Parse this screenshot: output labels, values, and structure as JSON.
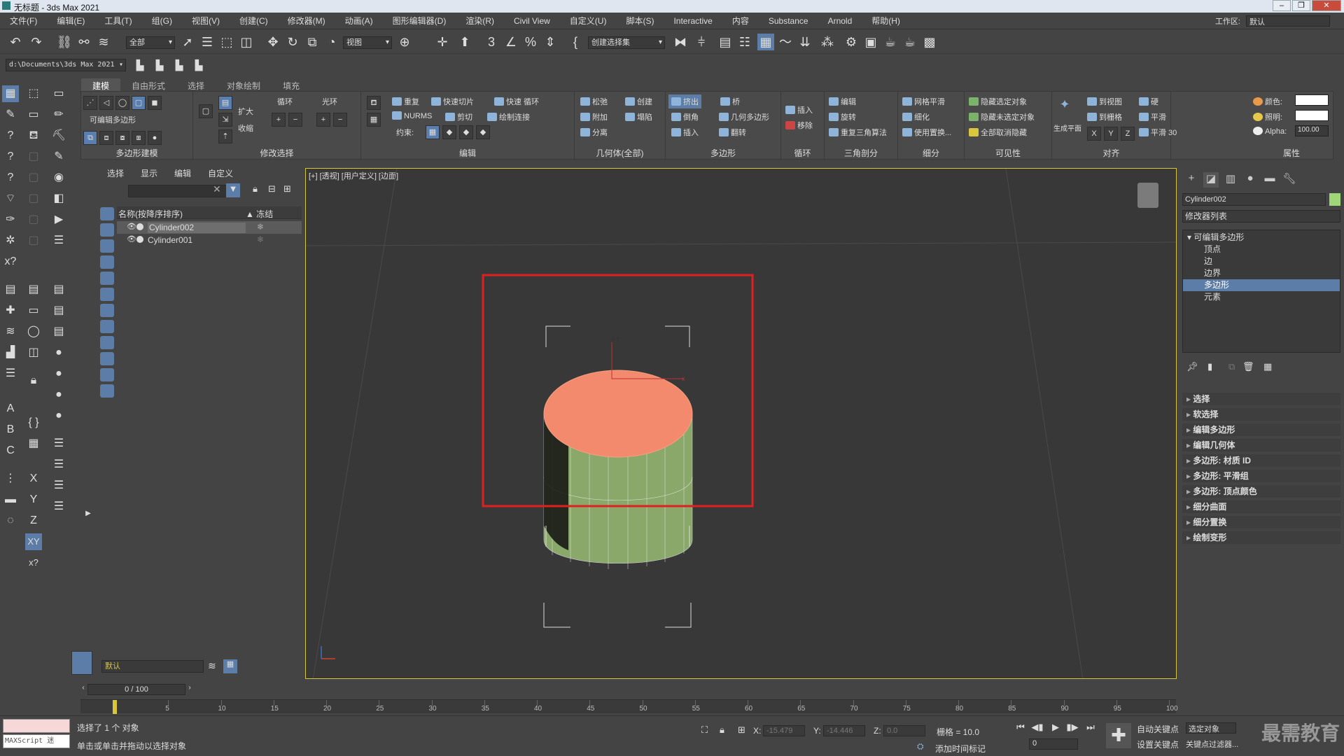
{
  "window": {
    "title": "无标题 - 3ds Max 2021"
  },
  "menu": [
    "文件(F)",
    "编辑(E)",
    "工具(T)",
    "组(G)",
    "视图(V)",
    "创建(C)",
    "修改器(M)",
    "动画(A)",
    "图形编辑器(D)",
    "渲染(R)",
    "Civil View",
    "自定义(U)",
    "脚本(S)",
    "Interactive",
    "内容",
    "Substance",
    "Arnold",
    "帮助(H)"
  ],
  "workspace": {
    "label": "工作区:",
    "value": "默认"
  },
  "toolbar": {
    "selection_filter": "全部",
    "ref_coord": "视图",
    "named_selection": "创建选择集",
    "project_path": "d:\\Documents\\3ds Max 2021"
  },
  "ribbon": {
    "tabs": [
      "建模",
      "自由形式",
      "选择",
      "对象绘制",
      "填充"
    ],
    "sections": {
      "poly_modeling": {
        "label": "多边形建模",
        "sub": "可编辑多边形"
      },
      "modify_selection": {
        "label": "修改选择",
        "grow": "扩大",
        "shrink": "收缩",
        "loop": "循环",
        "ring": "光环"
      },
      "edit": {
        "label": "编辑",
        "repeat": "重复",
        "quickslice": "快速切片",
        "quickloop": "快速 循环",
        "nurms": "NURMS",
        "cut": "剪切",
        "paintconnect": "绘制连接",
        "constraint": "约束:"
      },
      "geometry": {
        "label": "几何体(全部)",
        "relax": "松弛",
        "create": "创建",
        "attach": "附加",
        "collapse": "塌陷",
        "detach": "分离"
      },
      "polygons": {
        "label": "多边形",
        "extrude": "挤出",
        "bridge": "桥",
        "bevel": "倒角",
        "geopoly": "几何多边形",
        "inset": "插入",
        "flip": "翻转"
      },
      "loops": {
        "label": "循环",
        "insert": "插入",
        "remove": "移除"
      },
      "tris": {
        "label": "三角剖分",
        "edit": "编辑",
        "turn": "旋转",
        "retri": "重复三角算法"
      },
      "subdiv": {
        "label": "细分",
        "meshsmooth": "网格平滑",
        "tess": "细化",
        "usedisp": "使用置换..."
      },
      "vis": {
        "label": "可见性",
        "hidesel": "隐藏选定对象",
        "hideunsel": "隐藏未选定对象",
        "unhide": "全部取消隐藏"
      },
      "align": {
        "label": "对齐",
        "makeplanar": "生成平面",
        "toview": "到视图",
        "togrid": "到栅格",
        "x": "X",
        "y": "Y",
        "z": "Z"
      },
      "smooth": {
        "hard": "硬",
        "smooth": "平滑",
        "smooth30": "平滑 30"
      },
      "props": {
        "label": "属性",
        "color": "颜色:",
        "illum": "照明:",
        "alpha": "Alpha:",
        "alpha_val": "100.00"
      }
    }
  },
  "scene_explorer": {
    "tabs": [
      "选择",
      "显示",
      "编辑",
      "自定义"
    ],
    "header_name": "名称(按降序排序)",
    "header_freeze": "▲ 冻结",
    "rows": [
      {
        "name": "Cylinder002",
        "selected": true
      },
      {
        "name": "Cylinder001",
        "selected": false
      }
    ],
    "layer": "默认"
  },
  "viewport": {
    "label": "[+] [透视] [用户定义] [边面]"
  },
  "command_panel": {
    "object_name": "Cylinder002",
    "modifier_list": "修改器列表",
    "stack": [
      {
        "label": "可编辑多边形",
        "level": 0,
        "selected": false
      },
      {
        "label": "顶点",
        "level": 1,
        "selected": false
      },
      {
        "label": "边",
        "level": 1,
        "selected": false
      },
      {
        "label": "边界",
        "level": 1,
        "selected": false
      },
      {
        "label": "多边形",
        "level": 1,
        "selected": true
      },
      {
        "label": "元素",
        "level": 1,
        "selected": false
      }
    ],
    "rollouts": [
      "选择",
      "软选择",
      "编辑多边形",
      "编辑几何体",
      "多边形: 材质 ID",
      "多边形: 平滑组",
      "多边形: 顶点颜色",
      "细分曲面",
      "细分置换",
      "绘制变形"
    ]
  },
  "timeline": {
    "frame": "0 / 100",
    "ticks": [
      "0",
      "5",
      "10",
      "15",
      "20",
      "25",
      "30",
      "35",
      "40",
      "45",
      "50",
      "55",
      "60",
      "65",
      "70",
      "75",
      "80",
      "85",
      "90",
      "95",
      "100"
    ]
  },
  "status": {
    "maxscript": "MAXScript 迷",
    "selected": "选择了 1 个 对象",
    "prompt": "单击或单击并拖动以选择对象",
    "x_label": "X:",
    "x": "-15.479",
    "y_label": "Y:",
    "y": "-14.446",
    "z_label": "Z:",
    "z": "0.0",
    "grid": "栅格 = 10.0",
    "add_time_tag": "添加时间标记",
    "autokey": "自动关键点",
    "setkey": "设置关键点",
    "sel_obj": "选定对象",
    "key_filters": "关键点过滤器...",
    "frame_field": "0",
    "watermark": "最需教育"
  },
  "colors": {
    "accent": "#5b7da8",
    "top_face": "#f48a6d",
    "side_face": "#8aa86a",
    "highlight_box": "#e02020",
    "viewport_border": "#d8c63c"
  }
}
